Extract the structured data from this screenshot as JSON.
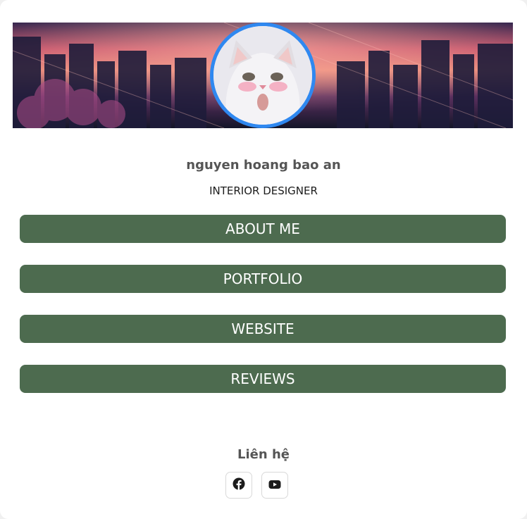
{
  "profile": {
    "name": "nguyen hoang bao an",
    "role": "INTERIOR DESIGNER",
    "avatar_icon": "cat-photo-avatar",
    "accent_color": "#2f88f0"
  },
  "links": [
    {
      "label": "ABOUT ME"
    },
    {
      "label": "PORTFOLIO"
    },
    {
      "label": "WEBSITE"
    },
    {
      "label": "REVIEWS"
    }
  ],
  "button_color": "#4d6b4f",
  "contact": {
    "title": "Liên hệ",
    "socials": [
      {
        "icon": "facebook-icon"
      },
      {
        "icon": "youtube-icon"
      }
    ]
  }
}
